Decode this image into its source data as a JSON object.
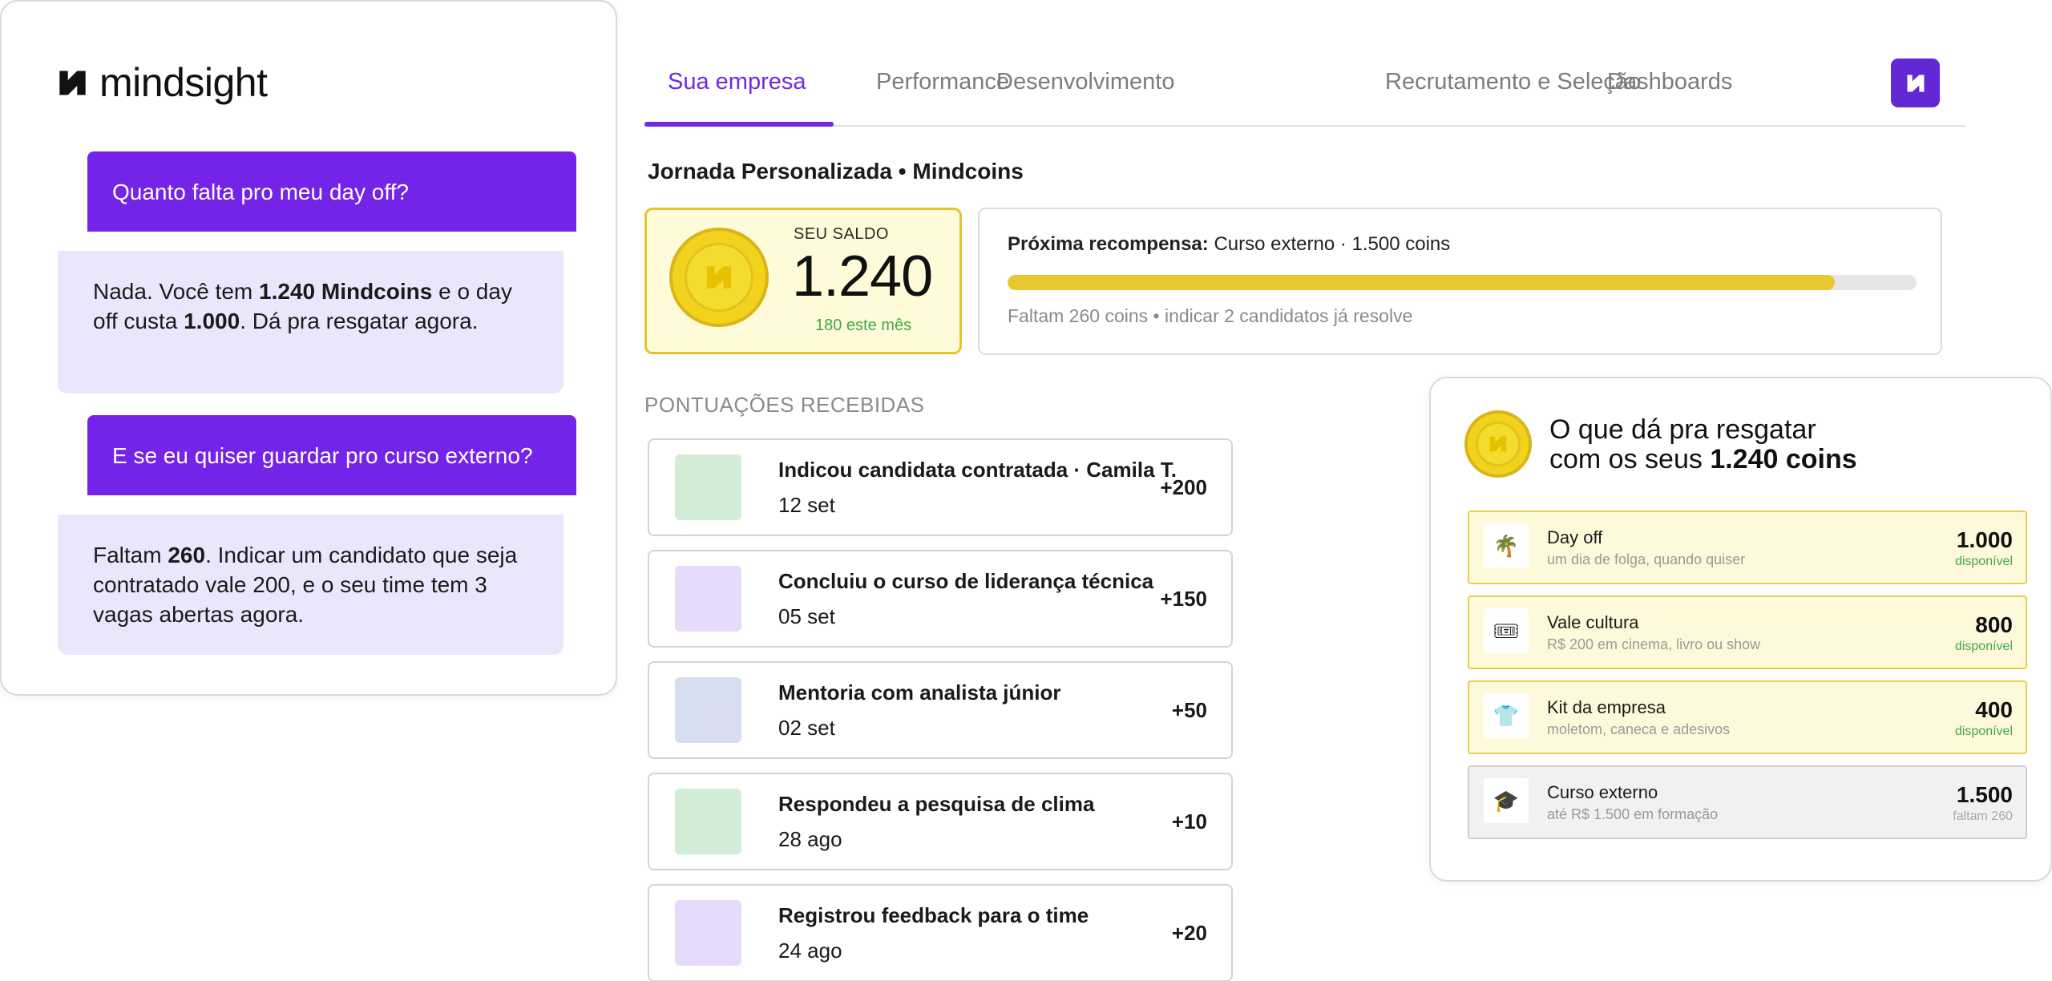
{
  "brand": {
    "name": "mindsight"
  },
  "chat": {
    "messages": [
      {
        "role": "user",
        "text": "Quanto falta pro meu day off?"
      },
      {
        "role": "bot",
        "parts": [
          "Nada. Você tem ",
          "1.240 Mindcoins",
          " e o day off custa ",
          "1.000",
          ". Dá pra resgatar agora."
        ]
      },
      {
        "role": "user",
        "text": "E se eu quiser guardar pro curso externo?"
      },
      {
        "role": "bot",
        "parts": [
          "Faltam ",
          "260",
          ". Indicar um candidato que seja contratado vale 200, e o seu time tem 3 vagas abertas agora."
        ]
      }
    ]
  },
  "nav": {
    "tabs": [
      {
        "label": "Sua empresa",
        "active": true
      },
      {
        "label": "Performance",
        "active": false
      },
      {
        "label": "Desenvolvimento",
        "active": false
      },
      {
        "label": "Recrutamento e Seleção",
        "active": false
      },
      {
        "label": "Dashboards",
        "active": false
      }
    ],
    "logo_icon": "mindsight-logo-icon"
  },
  "page": {
    "title": "Jornada Personalizada • Mindcoins"
  },
  "balance": {
    "label": "SEU SALDO",
    "value": "1.240",
    "month": "180 este mês"
  },
  "next_reward": {
    "label": "Próxima recompensa:",
    "value": "Curso externo · 1.500 coins",
    "progress": 0.91,
    "hint": "Faltam 260 coins • indicar 2 candidatos já resolve"
  },
  "received": {
    "title": "PONTUAÇÕES RECEBIDAS",
    "items": [
      {
        "title": "Indicou candidata contratada · Camila T.",
        "date": "12 set",
        "points": "+200",
        "color": "#d3ecd6"
      },
      {
        "title": "Concluiu o curso de liderança técnica",
        "date": "05 set",
        "points": "+150",
        "color": "#e6dbfb"
      },
      {
        "title": "Mentoria com analista júnior",
        "date": "02 set",
        "points": "+50",
        "color": "#d6deef"
      },
      {
        "title": "Respondeu a pesquisa de clima",
        "date": "28 ago",
        "points": "+10",
        "color": "#d3ecd6"
      },
      {
        "title": "Registrou feedback para o time",
        "date": "24 ago",
        "points": "+20",
        "color": "#e6dbfb"
      }
    ]
  },
  "redeem": {
    "title_line1": "O que dá pra resgatar",
    "title_line2_prefix": "com os seus ",
    "title_line2_bold": "1.240 coins",
    "options": [
      {
        "name": "Day off",
        "desc": "um dia de folga, quando quiser",
        "cost": "1.000",
        "status": "disponível",
        "icon": "palm-tree-icon",
        "glyph": "🌴",
        "available": true
      },
      {
        "name": "Vale cultura",
        "desc": "R$ 200 em cinema, livro ou show",
        "cost": "800",
        "status": "disponível",
        "icon": "ticket-icon",
        "glyph": "🎟",
        "available": true
      },
      {
        "name": "Kit da empresa",
        "desc": "moletom, caneca e adesivos",
        "cost": "400",
        "status": "disponível",
        "icon": "tshirt-icon",
        "glyph": "👕",
        "available": true
      },
      {
        "name": "Curso externo",
        "desc": "até R$ 1.500 em formação",
        "cost": "1.500",
        "status": "faltam 260",
        "icon": "graduation-cap-icon",
        "glyph": "🎓",
        "available": false
      }
    ]
  },
  "colors": {
    "accent": "#6d2ae2",
    "user_bubble": "#7424e8",
    "bot_bubble": "#ece6fd",
    "coin": "#f2d21d",
    "progress": "#e8c730",
    "positive": "#3fa84a"
  }
}
